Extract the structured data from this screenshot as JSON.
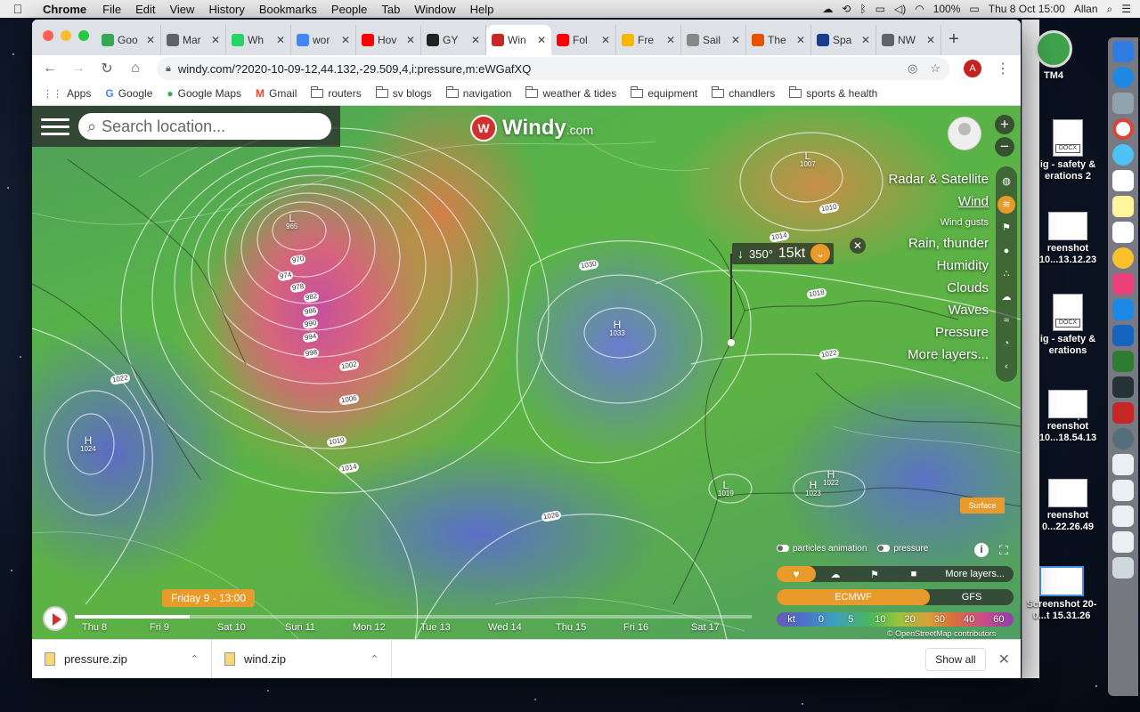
{
  "menubar": {
    "app": "Chrome",
    "items": [
      "File",
      "Edit",
      "View",
      "History",
      "Bookmarks",
      "People",
      "Tab",
      "Window",
      "Help"
    ],
    "battery": "100%",
    "clock": "Thu 8 Oct  15:00",
    "user": "Allan"
  },
  "tabs": [
    {
      "title": "Goo",
      "color": "#34a853",
      "active": false
    },
    {
      "title": "Mar",
      "color": "#5f6368",
      "active": false
    },
    {
      "title": "Wh",
      "color": "#25d366",
      "active": false
    },
    {
      "title": "wor",
      "color": "#4285f4",
      "active": false
    },
    {
      "title": "Hov",
      "color": "#ff0000",
      "active": false
    },
    {
      "title": "GY",
      "color": "#222222",
      "active": false
    },
    {
      "title": "Win",
      "color": "#c62828",
      "active": true
    },
    {
      "title": "Fol",
      "color": "#ff0000",
      "active": false
    },
    {
      "title": "Fre",
      "color": "#f6b600",
      "active": false
    },
    {
      "title": "Sail",
      "color": "#888888",
      "active": false
    },
    {
      "title": "The",
      "color": "#e65100",
      "active": false
    },
    {
      "title": "Spa",
      "color": "#1a3c8e",
      "active": false
    },
    {
      "title": "NW",
      "color": "#5f6368",
      "active": false
    }
  ],
  "address": {
    "url": "windy.com/?2020-10-09-12,44.132,-29.509,4,i:pressure,m:eWGafXQ",
    "profile_initial": "A"
  },
  "bookmarks": [
    {
      "label": "Apps",
      "icon": "apps-grid-icon"
    },
    {
      "label": "Google",
      "icon": "google-icon"
    },
    {
      "label": "Google Maps",
      "icon": "maps-pin-icon"
    },
    {
      "label": "Gmail",
      "icon": "gmail-icon"
    },
    {
      "label": "routers",
      "icon": "folder-icon"
    },
    {
      "label": "sv blogs",
      "icon": "folder-icon"
    },
    {
      "label": "navigation",
      "icon": "folder-icon"
    },
    {
      "label": "weather & tides",
      "icon": "folder-icon"
    },
    {
      "label": "equipment",
      "icon": "folder-icon"
    },
    {
      "label": "chandlers",
      "icon": "folder-icon"
    },
    {
      "label": "sports & health",
      "icon": "folder-icon"
    }
  ],
  "windy": {
    "search_placeholder": "Search location...",
    "logo_name": "Windy",
    "logo_domain": ".com",
    "layers": [
      {
        "label": "Radar & Satellite",
        "selected": false,
        "small": false
      },
      {
        "label": "Wind",
        "selected": true,
        "small": false
      },
      {
        "label": "Wind gusts",
        "selected": false,
        "small": true
      },
      {
        "label": "Rain, thunder",
        "selected": false,
        "small": false
      },
      {
        "label": "Humidity",
        "selected": false,
        "small": false
      },
      {
        "label": "Clouds",
        "selected": false,
        "small": false
      },
      {
        "label": "Waves",
        "selected": false,
        "small": false
      },
      {
        "label": "Pressure",
        "selected": false,
        "small": false
      },
      {
        "label": "More layers...",
        "selected": false,
        "small": false
      }
    ],
    "tooltip": {
      "direction": "350°",
      "speed": "15kt"
    },
    "surface_label": "Surface",
    "particles_label": "particles animation",
    "pressure_label": "pressure",
    "more_layers": "More layers...",
    "models": {
      "primary": "ECMWF",
      "secondary": "GFS"
    },
    "scale": [
      "kt",
      "0",
      "5",
      "10",
      "20",
      "30",
      "40",
      "60"
    ],
    "attribution": "© OpenStreetMap contributors",
    "time_badge": "Friday 9 - 13:00",
    "timeline_progress": 0.17,
    "days": [
      "Thu 8",
      "Fri 9",
      "Sat 10",
      "Sun 11",
      "Mon 12",
      "Tue 13",
      "Wed 14",
      "Thu 15",
      "Fri 16",
      "Sat 17"
    ],
    "pressure_centers": [
      {
        "letter": "L",
        "value": "965"
      },
      {
        "letter": "H",
        "value": "1033"
      },
      {
        "letter": "H",
        "value": "1024"
      },
      {
        "letter": "L",
        "value": "1019"
      },
      {
        "letter": "H",
        "value": "1023"
      },
      {
        "letter": "H",
        "value": "1022"
      },
      {
        "letter": "L",
        "value": "1007"
      }
    ],
    "isobar_labels": [
      "970",
      "974",
      "978",
      "982",
      "986",
      "990",
      "994",
      "998",
      "1002",
      "1006",
      "1010",
      "1014",
      "1022",
      "1030",
      "1026",
      "1010",
      "1014",
      "1018",
      "1022"
    ]
  },
  "downloads": {
    "items": [
      "pressure.zip",
      "wind.zip"
    ],
    "show_all": "Show all"
  },
  "desktop": {
    "items": [
      "TM4",
      "ig - safety & erations 2",
      "reenshot 10...13.12.23",
      "ig - safety & erations",
      "reenshot 10...18.54.13",
      "reenshot 0...22.26.49",
      "Screenshot 20-0...t 15.31.26"
    ],
    "docx_badge": "DOCX"
  }
}
